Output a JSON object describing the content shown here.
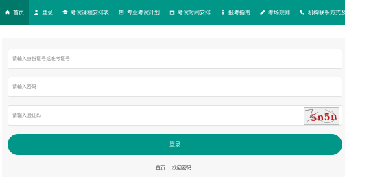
{
  "nav": {
    "items": [
      {
        "label": "首页",
        "icon": "home-icon"
      },
      {
        "label": "登录",
        "icon": "user-icon"
      },
      {
        "label": "考试课程安排表",
        "icon": "graduation-cap-icon"
      },
      {
        "label": "专业考试计划",
        "icon": "book-icon"
      },
      {
        "label": "考试时间安排",
        "icon": "calendar-icon"
      },
      {
        "label": "报考指南",
        "icon": "info-icon"
      },
      {
        "label": "考场规则",
        "icon": "pencil-icon"
      },
      {
        "label": "机构联系方式及公告",
        "icon": "phone-icon"
      }
    ],
    "active_index": 0
  },
  "form": {
    "id_placeholder": "请输入身份证号或准考证号",
    "password_placeholder": "请输入密码",
    "captcha_placeholder": "请输入验证码",
    "captcha_text": "5n5n",
    "login_label": "登录"
  },
  "links": {
    "home": "首页",
    "recover_password": "找回密码"
  },
  "colors": {
    "primary": "#009688",
    "active": "#00796b",
    "panel_bg": "#f7f7f7"
  }
}
